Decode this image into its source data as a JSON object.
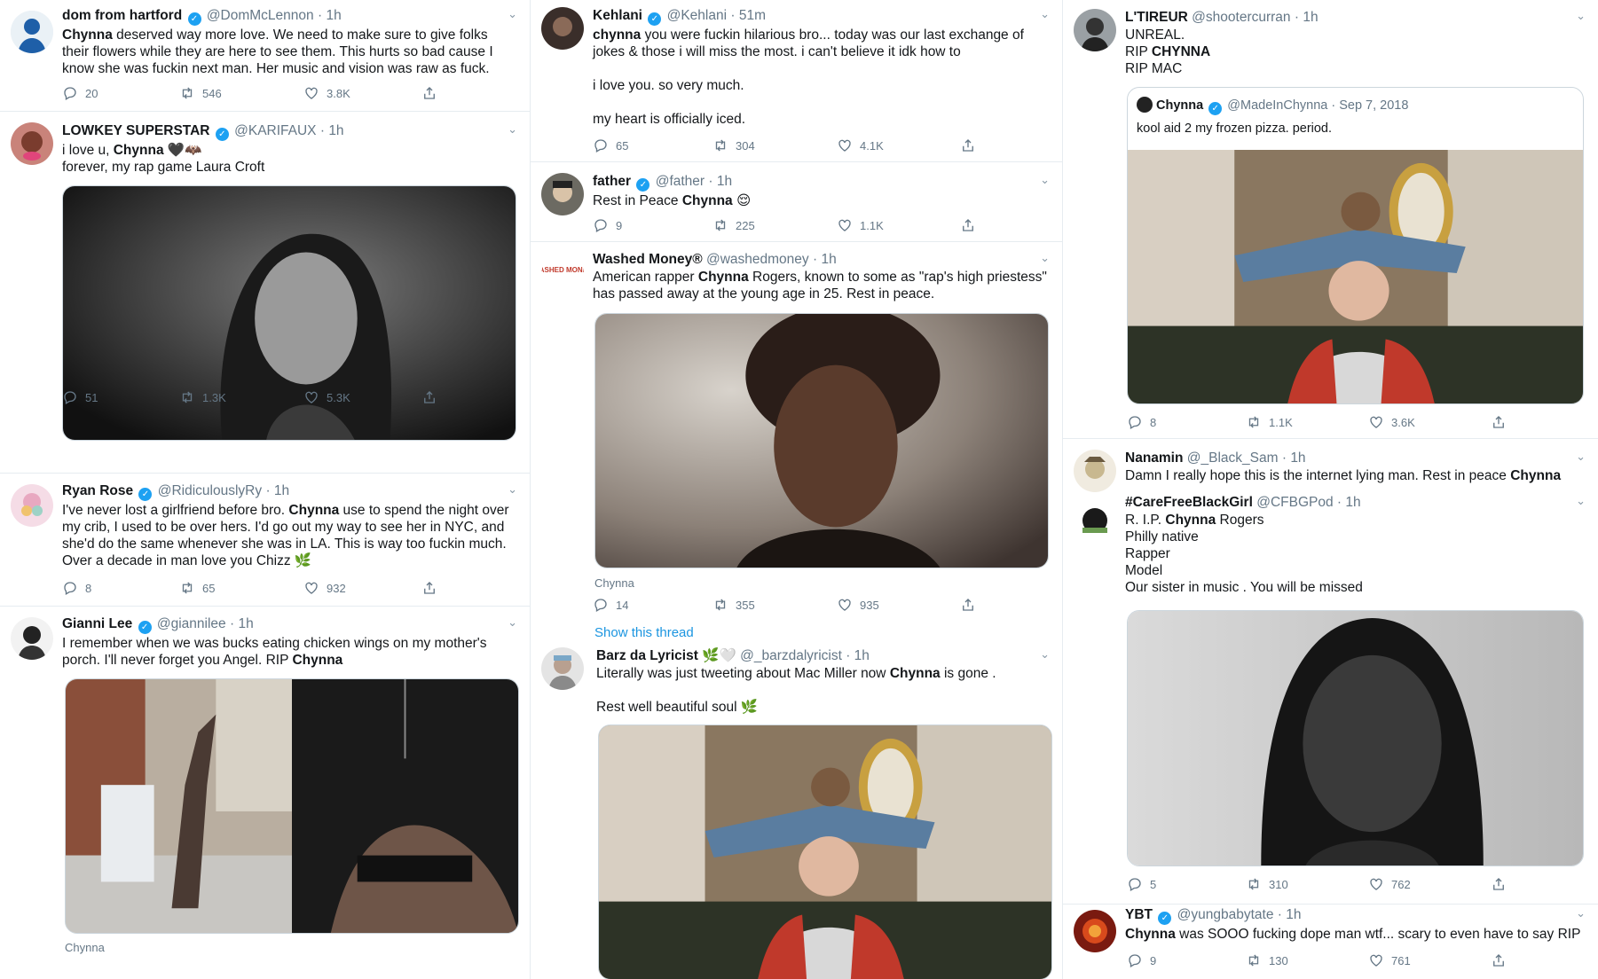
{
  "tweets": {
    "t1": {
      "name": "dom from hartford",
      "handle": "@DomMcLennon",
      "time": "1h",
      "text_bold": "Chynna",
      "text_rest": " deserved way more love. We need to make sure to give folks their flowers while they are here to see them. This hurts so bad cause I know she was fuckin next man. Her music and vision was raw as fuck.",
      "replies": "20",
      "retweets": "546",
      "likes": "3.8K"
    },
    "t2": {
      "name": "LOWKEY SUPERSTAR",
      "handle": "@KARIFAUX",
      "time": "1h",
      "line1_pre": "i love u, ",
      "line1_bold": "Chynna",
      "line1_emoji": "🖤🦇",
      "line2": "forever, my rap game Laura Croft",
      "replies": "51",
      "retweets": "1.3K",
      "likes": "5.3K"
    },
    "t3": {
      "name": "Ryan Rose",
      "handle": "@RidiculouslyRy",
      "time": "1h",
      "text_pre": "I've never lost a girlfriend before bro. ",
      "text_bold": "Chynna",
      "text_rest": " use to spend the night over my crib, I used to be over hers. I'd go out my way to see her in NYC, and she'd do the same whenever she was in LA. This is way too fuckin much. Over a decade in man love you Chizz 🌿",
      "replies": "8",
      "retweets": "65",
      "likes": "932"
    },
    "t4": {
      "name": "Gianni Lee",
      "handle": "@giannilee",
      "time": "1h",
      "text_pre": "I remember when we was bucks eating chicken wings on my mother's porch. I'll never forget you Angel. RIP ",
      "text_bold": "Chynna",
      "caption": "Chynna"
    },
    "t5": {
      "name": "Kehlani",
      "handle": "@Kehlani",
      "time": "51m",
      "text_bold": "chynna",
      "text_rest": " you were fuckin hilarious bro... today was our last exchange of jokes & those i will miss the most. i can't believe it idk how to",
      "line2": "i love you. so very much.",
      "line3": "my heart is officially iced.",
      "replies": "65",
      "retweets": "304",
      "likes": "4.1K"
    },
    "t6": {
      "name": "father",
      "handle": "@father",
      "time": "1h",
      "text_pre": "Rest in Peace ",
      "text_bold": "Chynna",
      "emoji": "😌",
      "replies": "9",
      "retweets": "225",
      "likes": "1.1K"
    },
    "t7": {
      "name": "Washed Money®",
      "handle": "@washedmoney",
      "time": "1h",
      "text_pre": "American rapper ",
      "text_bold": "Chynna",
      "text_rest": " Rogers, known to some as \"rap's high priestess\" has passed away at the young age in 25. Rest in peace.",
      "caption": "Chynna",
      "replies": "14",
      "retweets": "355",
      "likes": "935",
      "show_thread": "Show this thread",
      "avatar_text": "WASHED MONEY"
    },
    "t8": {
      "name": "Barz da Lyricist",
      "name_emoji": "🌿🤍",
      "handle": "@_barzdalyricist",
      "time": "1h",
      "text_pre": "Literally was just tweeting about Mac Miller now ",
      "text_bold": "Chynna",
      "text_rest": " is gone .",
      "line2": "Rest well beautiful soul 🌿"
    },
    "t9": {
      "name": "L'TIREUR",
      "handle": "@shootercurran",
      "time": "1h",
      "line1": "UNREAL.",
      "line2_pre": "RIP ",
      "line2_bold": "CHYNNA",
      "line3": "RIP MAC",
      "quote": {
        "name": "Chynna",
        "handle": "@MadeInChynna",
        "time": "Sep 7, 2018",
        "text": "kool aid 2 my frozen pizza. period."
      },
      "replies": "8",
      "retweets": "1.1K",
      "likes": "3.6K"
    },
    "t10": {
      "name": "Nanamin",
      "handle": "@_Black_Sam",
      "time": "1h",
      "text_pre": "Damn I really hope this is the internet lying man.  Rest in peace ",
      "text_bold": "Chynna"
    },
    "t11": {
      "name": "#CareFreeBlackGirl",
      "handle": "@CFBGPod",
      "time": "1h",
      "line1_pre": "R. I.P. ",
      "line1_bold": "Chynna",
      "line1_rest": " Rogers",
      "line2": "Philly native",
      "line3": "Rapper",
      "line4": "Model",
      "line5": "Our sister in music . You will be missed",
      "replies": "5",
      "retweets": "310",
      "likes": "762"
    },
    "t12": {
      "name": "YBT",
      "handle": "@yungbabytate",
      "time": "1h",
      "text_bold": "Chynna",
      "text_rest": " was SOOO fucking dope man wtf... scary to even have to say RIP",
      "replies": "9",
      "retweets": "130",
      "likes": "761"
    }
  },
  "colors": {
    "verified": "#1da1f2",
    "link": "#1b95e0",
    "muted": "#657786",
    "divider": "#e6ecf0"
  },
  "icons": [
    "reply-icon",
    "retweet-icon",
    "like-icon",
    "share-icon",
    "verified-icon",
    "chevron-down-icon"
  ]
}
